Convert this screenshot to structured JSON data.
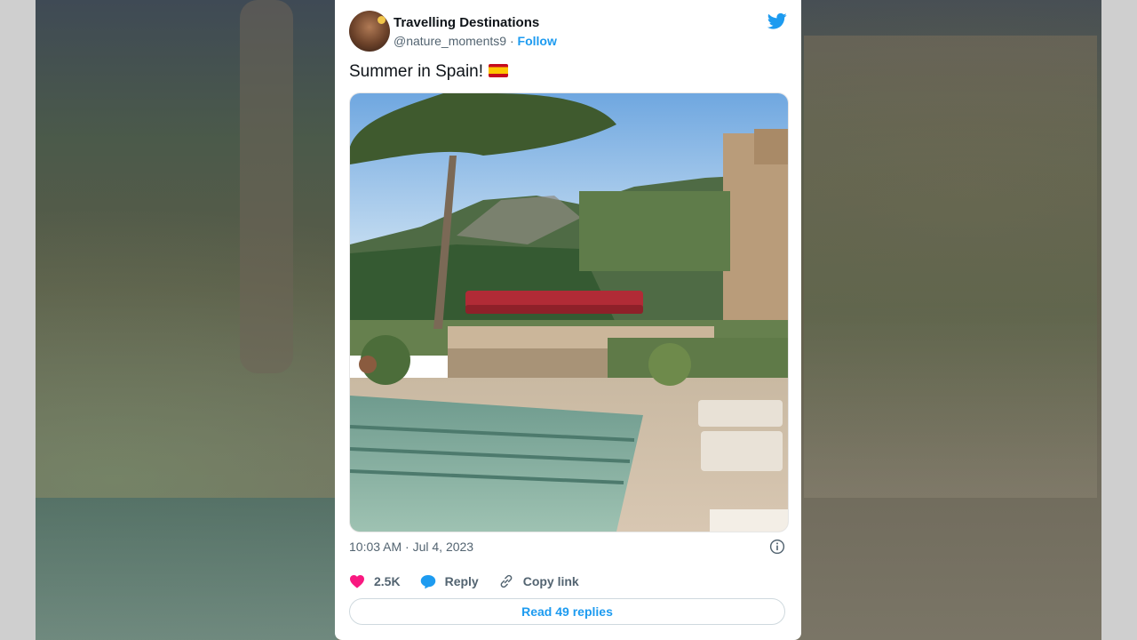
{
  "tweet": {
    "author_name": "Travelling Destinations",
    "handle": "@nature_moments9",
    "separator": " · ",
    "follow_label": "Follow",
    "text": "Summer in Spain!",
    "timestamp": "10:03 AM · Jul 4, 2023",
    "likes_count": "2.5K",
    "reply_label": "Reply",
    "copy_link_label": "Copy link",
    "read_replies_label": "Read 49 replies"
  },
  "icons": {
    "brand": "twitter-bird-icon",
    "flag": "spain-flag-emoji",
    "like": "heart-icon",
    "reply": "speech-bubble-icon",
    "copy_link": "link-icon",
    "info": "info-icon"
  },
  "colors": {
    "accent": "#1d9bf0",
    "like": "#f91880",
    "text_primary": "#0f1419",
    "text_secondary": "#536471"
  }
}
